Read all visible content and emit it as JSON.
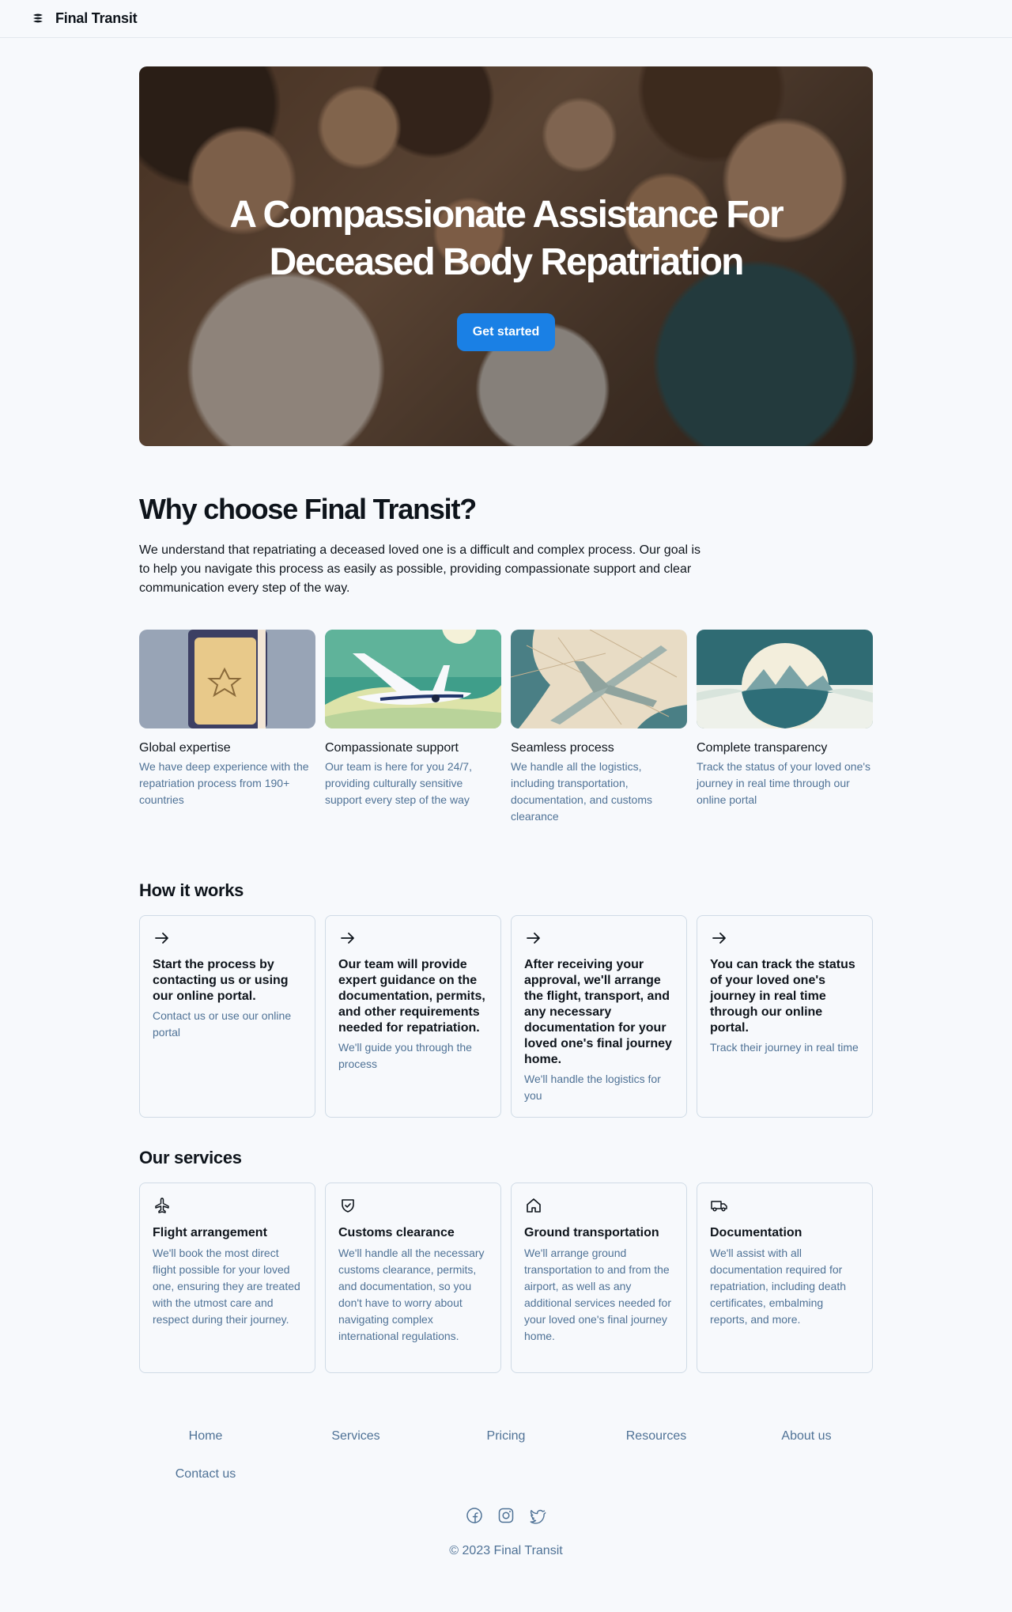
{
  "header": {
    "brand": "Final Transit",
    "logo_icon": "layers-logo-icon"
  },
  "hero": {
    "title": "A Compassionate Assistance For Deceased Body Repatriation",
    "cta_label": "Get started"
  },
  "why": {
    "title": "Why choose Final Transit?",
    "text": "We understand that repatriating a deceased loved one is a difficult and complex process. Our goal is to help you navigate this process as easily as possible, providing compassionate support and clear communication every step of the way.",
    "features": [
      {
        "title": "Global expertise",
        "text": "We have deep experience with the repatriation process from 190+ countries"
      },
      {
        "title": "Compassionate support",
        "text": "Our team is here for you 24/7, providing culturally sensitive support every step of the way"
      },
      {
        "title": "Seamless process",
        "text": "We handle all the logistics, including transportation, documentation, and customs clearance"
      },
      {
        "title": "Complete transparency",
        "text": "Track the status of your loved one's journey in real time through our online portal"
      }
    ]
  },
  "how": {
    "title": "How it works",
    "steps": [
      {
        "icon": "arrow-right-icon",
        "title": "Start the process by contacting us or using our online portal.",
        "text": "Contact us or use our online portal"
      },
      {
        "icon": "arrow-right-icon",
        "title": "Our team will provide expert guidance on the documentation, permits, and other requirements needed for repatriation.",
        "text": "We'll guide you through the process"
      },
      {
        "icon": "arrow-right-icon",
        "title": "After receiving your approval, we'll arrange the flight, transport, and any necessary documentation for your loved one's final journey home.",
        "text": "We'll handle the logistics for you"
      },
      {
        "icon": "arrow-right-icon",
        "title": "You can track the status of your loved one's journey in real time through our online portal.",
        "text": "Track their journey in real time"
      }
    ]
  },
  "services": {
    "title": "Our services",
    "items": [
      {
        "icon": "airplane-icon",
        "title": "Flight arrangement",
        "text": "We'll book the most direct flight possible for your loved one, ensuring they are treated with the utmost care and respect during their journey."
      },
      {
        "icon": "shield-check-icon",
        "title": "Customs clearance",
        "text": "We'll handle all the necessary customs clearance, permits, and documentation, so you don't have to worry about navigating complex international regulations."
      },
      {
        "icon": "house-icon",
        "title": "Ground transportation",
        "text": "We'll arrange ground transportation to and from the airport, as well as any additional services needed for your loved one's final journey home."
      },
      {
        "icon": "truck-icon",
        "title": "Documentation",
        "text": "We'll assist with all documentation required for repatriation, including death certificates, embalming reports, and more."
      }
    ]
  },
  "footer": {
    "links": [
      "Home",
      "Services",
      "Pricing",
      "Resources",
      "About us",
      "Contact us"
    ],
    "socials": [
      "facebook-icon",
      "instagram-icon",
      "twitter-icon"
    ],
    "copyright": "© 2023 Final Transit"
  },
  "colors": {
    "accent": "#1a80e5",
    "muted_text": "#4f7296",
    "background": "#f7f9fc",
    "border": "#d0dbe6"
  }
}
